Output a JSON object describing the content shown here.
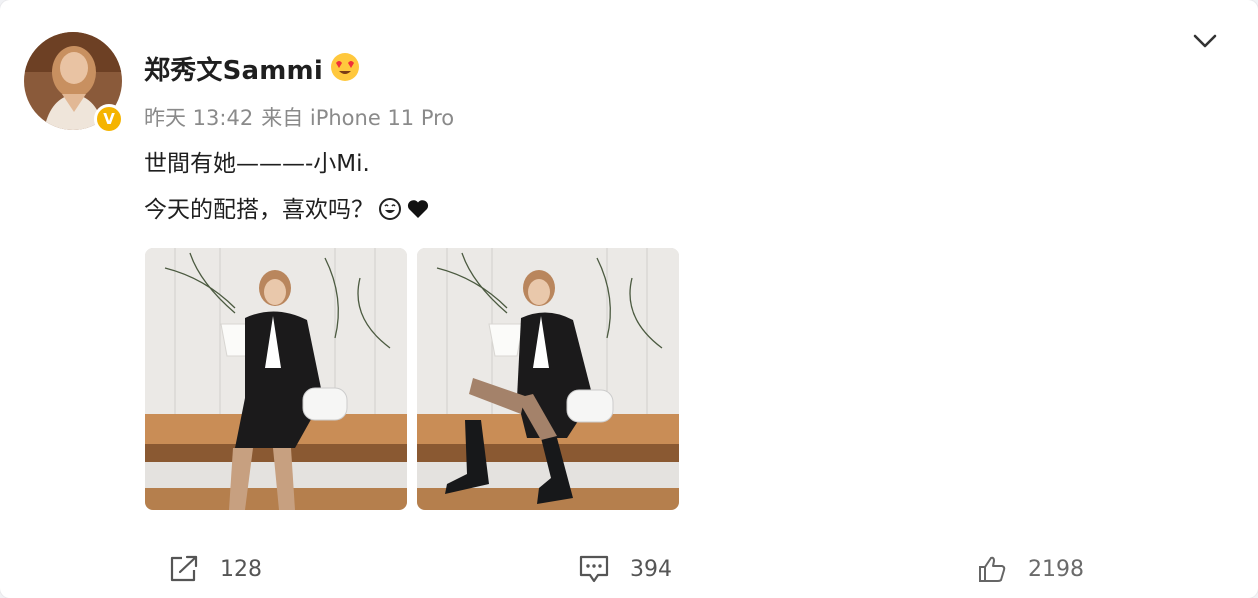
{
  "post": {
    "author": {
      "name": "郑秀文Sammi",
      "verified_mark": "V",
      "avatar_icon": "avatar-photo",
      "name_badge_icon": "heart-eyes-emoji-icon"
    },
    "meta": {
      "time": "昨天 13:42",
      "source": "来自 iPhone 11 Pro"
    },
    "text": {
      "line1": "世間有她———-小Mi.",
      "line2": "今天的配搭，喜欢吗？",
      "line2_emojis": [
        "smile-emoji-icon",
        "black-heart-icon"
      ]
    },
    "images": [
      {
        "name": "photo-1"
      },
      {
        "name": "photo-2"
      }
    ],
    "actions": {
      "share_count": "128",
      "comment_count": "394",
      "like_count": "2198"
    },
    "colors": {
      "text": "#1f1f1f",
      "meta": "#8a8a8a",
      "verified": "#f5b400"
    }
  }
}
